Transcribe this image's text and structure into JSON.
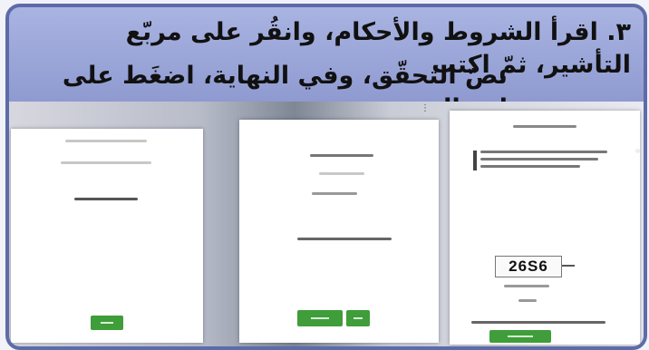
{
  "caption": {
    "line1": "٣. اقرأ الشروط والأحكام، وانقُر على مربّع التأشير، ثمّ اكتب",
    "line2": "نصّ التحقّق، وفي النهاية، اضغَط على إرسال."
  },
  "panel3": {
    "captcha_text": "26S6"
  },
  "colors": {
    "frame": "#5d6ca8",
    "caption_bg": "#a9b4e2",
    "button_green": "#3f9d3a"
  }
}
